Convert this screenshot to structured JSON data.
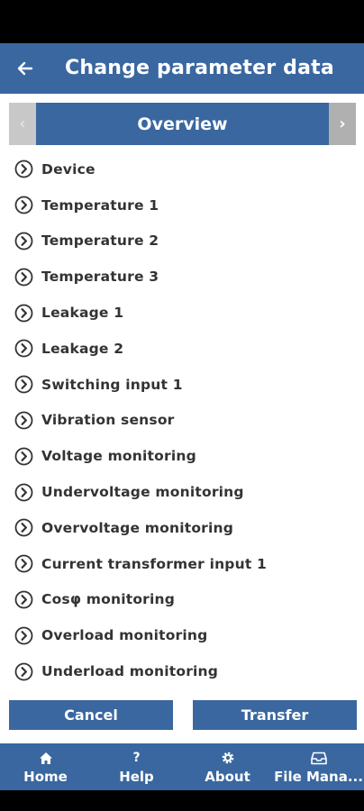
{
  "header": {
    "title": "Change parameter data",
    "back_icon": "arrow-left-icon"
  },
  "tabs": {
    "prev_glyph": "‹",
    "active_label": "Overview",
    "next_glyph": "›"
  },
  "parameters": [
    "Device",
    "Temperature 1",
    "Temperature 2",
    "Temperature 3",
    "Leakage 1",
    "Leakage 2",
    "Switching input 1",
    "Vibration sensor",
    "Voltage monitoring",
    "Undervoltage monitoring",
    "Overvoltage monitoring",
    "Current transformer input 1",
    "Cosφ monitoring",
    "Overload monitoring",
    "Underload monitoring"
  ],
  "actions": {
    "cancel_label": "Cancel",
    "transfer_label": "Transfer"
  },
  "bottom_nav": [
    {
      "label": "Home",
      "icon": "home-icon"
    },
    {
      "label": "Help",
      "icon": "help-icon",
      "glyph": "?"
    },
    {
      "label": "About",
      "icon": "gear-icon"
    },
    {
      "label": "File Mana...",
      "icon": "inbox-icon"
    }
  ],
  "colors": {
    "primary": "#3a679f",
    "text": "#333333",
    "tab_disabled": "#c8c8c8",
    "tab_next": "#b0b0b0"
  }
}
